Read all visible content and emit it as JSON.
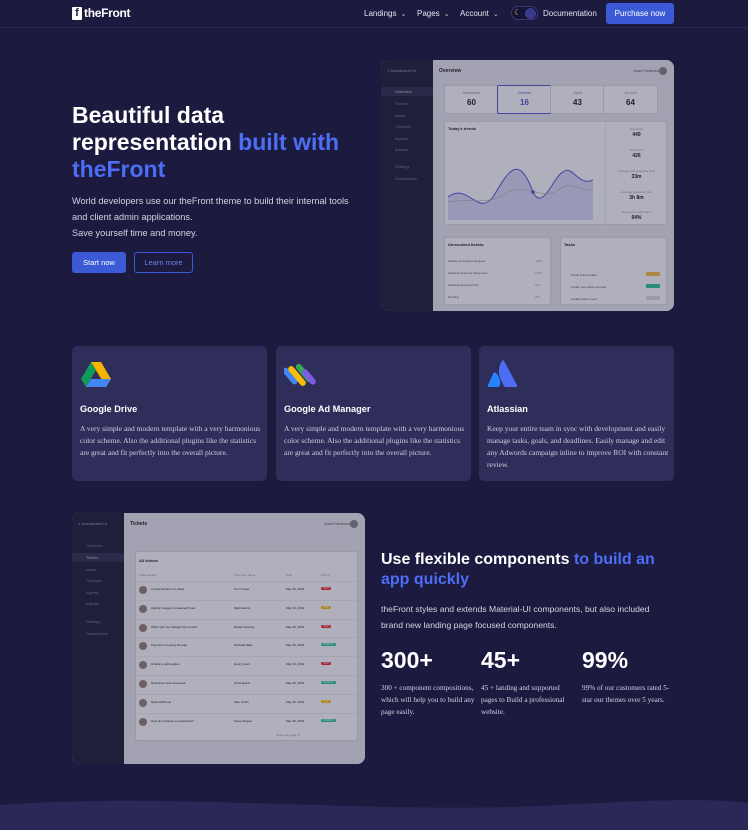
{
  "nav": {
    "logo_letter": "f",
    "logo_text": "theFront",
    "items": [
      {
        "label": "Landings"
      },
      {
        "label": "Pages"
      },
      {
        "label": "Account"
      }
    ],
    "documentation": "Documentation",
    "purchase": "Purchase now"
  },
  "hero": {
    "title_part1": "Beautiful data representation ",
    "title_accent": "built with theFront",
    "description_line1": "World developers use our theFront theme to build their internal tools and client admin applications.",
    "description_line2": "Save yourself time and money.",
    "primary_button": "Start now",
    "secondary_button": "Learn more"
  },
  "dashboard_mock": {
    "brand": "Dashboard Kit",
    "title": "Overview",
    "user": "Jones Ferdinand",
    "sidebar": [
      "Overview",
      "Tickets",
      "Ideas",
      "Contacts",
      "Agents",
      "Articles",
      "Settings",
      "Subscription"
    ],
    "kpis": [
      {
        "label": "Unresolved",
        "value": "60"
      },
      {
        "label": "Overdue",
        "value": "16"
      },
      {
        "label": "Open",
        "value": "43"
      },
      {
        "label": "On hold",
        "value": "64"
      }
    ],
    "trends_title": "Today's trends",
    "trend_stats": [
      {
        "label": "Resolved",
        "value": "449"
      },
      {
        "label": "Received",
        "value": "426"
      },
      {
        "label": "Average first response time",
        "value": "33m"
      },
      {
        "label": "Average response time",
        "value": "3h 8m"
      },
      {
        "label": "Resolution within SLA",
        "value": "94%"
      }
    ],
    "unresolved_title": "Unresolved tickets",
    "unresolved_rows": [
      {
        "label": "Waiting on Feature Request",
        "value": "4238"
      },
      {
        "label": "Awaiting Customer Response",
        "value": "1005"
      },
      {
        "label": "Awaiting Developer Fix",
        "value": "914"
      },
      {
        "label": "Pending",
        "value": "281"
      }
    ],
    "tasks_title": "Tasks",
    "tasks": [
      "Finish ticket update",
      "Create new ticket example",
      "Update ticket report"
    ]
  },
  "cards": [
    {
      "title": "Google Drive",
      "description": "A very simple and modern template with a very harmonious color scheme. Also the additional plugins like the statistics are great and fit perfectly into the overall picture.",
      "icon": "google-drive-icon"
    },
    {
      "title": "Google Ad Manager",
      "description": "A very simple and modern template with a very harmonious color scheme. Also the additional plugins like the statistics are great and fit perfectly into the overall picture.",
      "icon": "google-ad-manager-icon"
    },
    {
      "title": "Atlassian",
      "description": "Keep your entire team in sync with development and easily manage tasks, goals, and deadlines. Easily manage and edit any Adwords campaign inline to improve ROI with constant review.",
      "icon": "atlassian-icon"
    }
  ],
  "tickets_mock": {
    "brand": "Dashboard Kit",
    "title": "Tickets",
    "user": "Jones Ferdinand",
    "list_title": "All tickets",
    "columns": [
      "Ticket details",
      "Customer name",
      "Date",
      "Priority"
    ],
    "rows": [
      {
        "detail": "Contact Email not Linked",
        "customer": "Tom Cruise",
        "date": "May 26, 2019",
        "priority": "HIGH"
      },
      {
        "detail": "Adding Images to Featured Posts",
        "customer": "Matt Damon",
        "date": "May 26, 2019",
        "priority": "LOW"
      },
      {
        "detail": "When will I be charged this month?",
        "customer": "Robert Downey",
        "date": "May 26, 2019",
        "priority": "HIGH"
      },
      {
        "detail": "Payment not going through",
        "customer": "Christian Bale",
        "date": "May 25, 2019",
        "priority": "NORMAL"
      },
      {
        "detail": "Unable to add replies",
        "customer": "Henry Cavil",
        "date": "May 26, 2019",
        "priority": "HIGH"
      },
      {
        "detail": "Downtime since last week",
        "customer": "Chris Evans",
        "date": "May 26, 2019",
        "priority": "NORMAL"
      },
      {
        "detail": "Referral Bonus",
        "customer": "Sam Smith",
        "date": "May 26, 2019",
        "priority": "LOW"
      },
      {
        "detail": "How do I change my password?",
        "customer": "Steve Rogers",
        "date": "May 26, 2019",
        "priority": "NORMAL"
      }
    ],
    "footer": "Rows per page: 8"
  },
  "section2": {
    "title_part1": "Use flexible components ",
    "title_accent": "to build an app quickly",
    "description": "theFront styles and extends Material-UI components, but also included brand new landing page focused components."
  },
  "stats": [
    {
      "value": "300+",
      "description": "300 + component compositions, which will help you to build any page easily."
    },
    {
      "value": "45+",
      "description": "45 + landing and supported pages to Build a professional website."
    },
    {
      "value": "99%",
      "description": "99% of our customers rated 5-star our themes over 5 years."
    }
  ],
  "colors": {
    "background": "#1c1a3f",
    "accent": "#4c6ef5",
    "button": "#3d5ad6",
    "card": "#2f2d5a"
  }
}
